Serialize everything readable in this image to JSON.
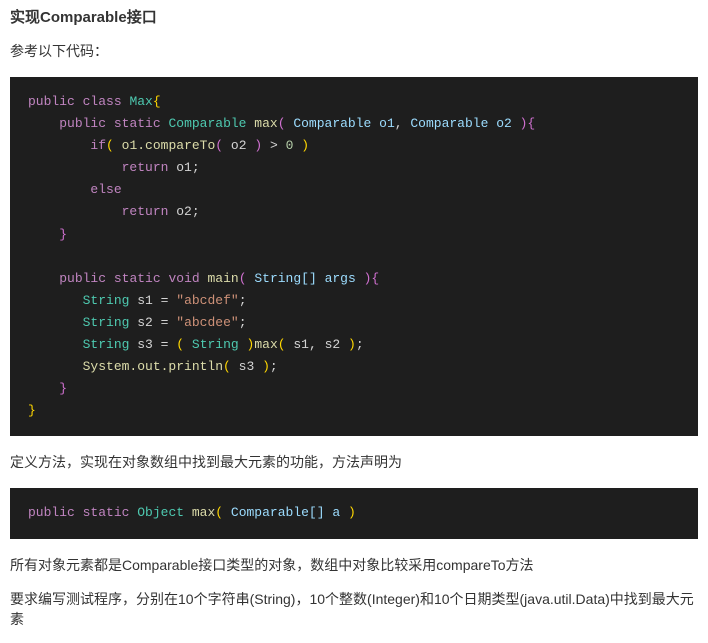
{
  "title": "实现Comparable接口",
  "para_ref": "参考以下代码：",
  "code1": {
    "kw_public": "public",
    "kw_class": "class",
    "cls_Max": "Max",
    "kw_static": "static",
    "type_Comparable": "Comparable",
    "fn_max": "max",
    "p_o1": "Comparable o1",
    "p_o2": "Comparable o2",
    "kw_if": "if",
    "call_compareTo": "o1.compareTo",
    "arg_o2": "o2",
    "op_gt": ">",
    "num_zero": "0",
    "kw_return": "return",
    "ret_o1": "o1",
    "kw_else": "else",
    "ret_o2": "o2",
    "kw_void": "void",
    "fn_main": "main",
    "p_args_type": "String[]",
    "p_args_name": "args",
    "type_String": "String",
    "var_s1": "s1",
    "eq": "=",
    "str_s1": "\"abcdef\"",
    "var_s2": "s2",
    "str_s2": "\"abcdee\"",
    "var_s3": "s3",
    "cast_String": "String",
    "call_max": "max",
    "args_s1s2_a": "s1",
    "args_s1s2_b": "s2",
    "call_println": "System.out.println",
    "arg_s3": "s3"
  },
  "para_def": "定义方法，实现在对象数组中找到最大元素的功能，方法声明为",
  "code2": {
    "kw_public": "public",
    "kw_static": "static",
    "type_Object": "Object",
    "fn_max": "max",
    "param": "Comparable[] a"
  },
  "para_tail1": "所有对象元素都是Comparable接口类型的对象，数组中对象比较采用compareTo方法",
  "para_tail2": "要求编写测试程序，分别在10个字符串(String)，10个整数(Integer)和10个日期类型(java.util.Data)中找到最大元素"
}
